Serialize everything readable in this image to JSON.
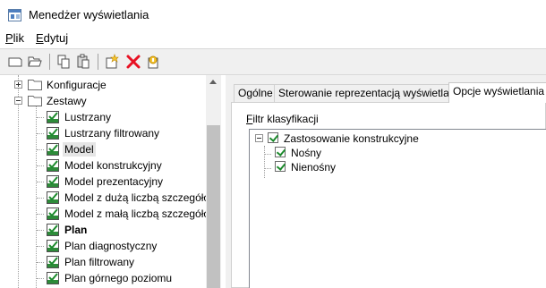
{
  "window": {
    "title": "Menedżer wyświetlania"
  },
  "menu": [
    {
      "label": "Plik",
      "mnemonic": "P",
      "rest": "lik"
    },
    {
      "label": "Edytuj",
      "mnemonic": "E",
      "rest": "dytuj"
    }
  ],
  "toolbar": {
    "icons": [
      "new-icon",
      "open-icon",
      "copy-icon",
      "paste-icon",
      "new-item-icon",
      "delete-icon",
      "purge-icon"
    ]
  },
  "tree": {
    "root_items": [
      {
        "label": "Konfiguracje",
        "expanded": false
      },
      {
        "label": "Zestawy",
        "expanded": true
      }
    ],
    "sets": [
      {
        "label": "Lustrzany"
      },
      {
        "label": "Lustrzany filtrowany"
      },
      {
        "label": "Model",
        "selected": true
      },
      {
        "label": "Model konstrukcyjny"
      },
      {
        "label": "Model prezentacyjny"
      },
      {
        "label": "Model z dużą liczbą szczegółów"
      },
      {
        "label": "Model z małą liczbą szczegółów"
      },
      {
        "label": "Plan",
        "bold": true
      },
      {
        "label": "Plan diagnostyczny"
      },
      {
        "label": "Plan filtrowany"
      },
      {
        "label": "Plan górnego poziomu"
      }
    ]
  },
  "tabs": [
    {
      "label": "Ogólne"
    },
    {
      "label": "Sterowanie reprezentacją wyświetlania"
    },
    {
      "label": "Opcje wyświetlania",
      "active": true
    }
  ],
  "filter": {
    "label": "Filtr klasyfikacji",
    "mnemonic": "F",
    "rest": "iltr klasyfikacji",
    "root": {
      "label": "Zastosowanie konstrukcyjne",
      "checked": true
    },
    "children": [
      {
        "label": "Nośny",
        "checked": true
      },
      {
        "label": "Nienośny",
        "checked": true
      }
    ]
  },
  "colors": {
    "accent_check": "#1c8a2c",
    "delete_red": "#e81123"
  }
}
